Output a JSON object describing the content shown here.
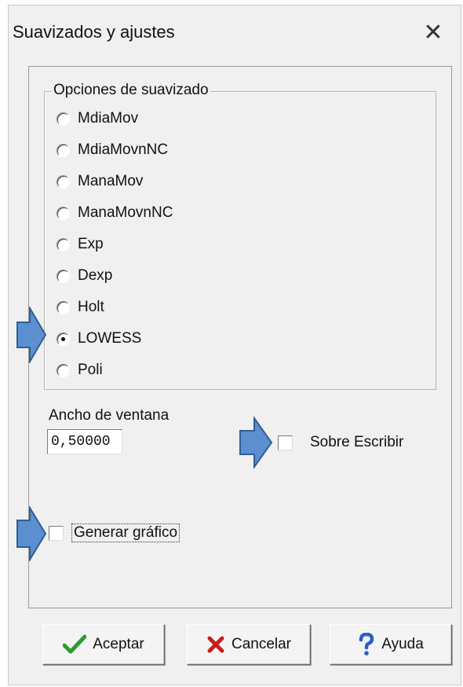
{
  "window": {
    "title": "Suavizados y ajustes",
    "close_glyph": "✕"
  },
  "smoothing_group": {
    "legend": "Opciones de suavizado",
    "options": [
      {
        "label": "MdiaMov",
        "selected": false
      },
      {
        "label": "MdiaMovnNC",
        "selected": false
      },
      {
        "label": "ManaMov",
        "selected": false
      },
      {
        "label": "ManaMovnNC",
        "selected": false
      },
      {
        "label": "Exp",
        "selected": false
      },
      {
        "label": "Dexp",
        "selected": false
      },
      {
        "label": "Holt",
        "selected": false
      },
      {
        "label": "LOWESS",
        "selected": true
      },
      {
        "label": "Poli",
        "selected": false
      }
    ]
  },
  "window_width": {
    "label": "Ancho de ventana",
    "value": "0,50000"
  },
  "overwrite": {
    "label": "Sobre Escribir",
    "checked": false
  },
  "generate_chart": {
    "label": "Generar gráfico",
    "checked": false
  },
  "buttons": {
    "accept": "Aceptar",
    "cancel": "Cancelar",
    "help": "Ayuda"
  },
  "colors": {
    "arrow_fill": "#5b8fd0",
    "arrow_stroke": "#2f5f94",
    "accept_check": "#2e9a2e",
    "cancel_x": "#c81e1e",
    "help_q": "#2a5fc8"
  }
}
